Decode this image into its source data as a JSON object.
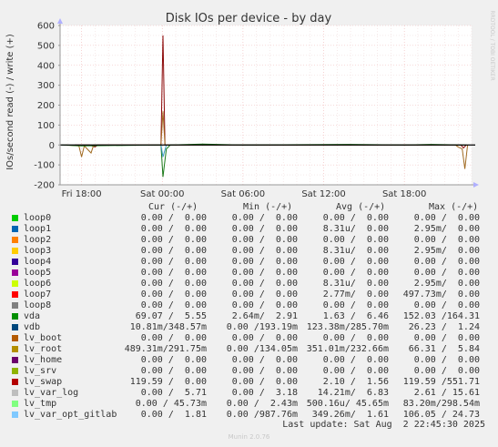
{
  "chart_data": {
    "type": "line",
    "title": "Disk IOs per device - by day",
    "ylabel": "IOs/second read (-) / write (+)",
    "ylim": [
      -200,
      600
    ],
    "yticks": [
      -200,
      -100,
      0,
      100,
      200,
      300,
      400,
      500,
      600
    ],
    "xticks": [
      {
        "label": "Fri 18:00",
        "t": 0
      },
      {
        "label": "Sat 00:00",
        "t": 6
      },
      {
        "label": "Sat 06:00",
        "t": 12
      },
      {
        "label": "Sat 12:00",
        "t": 18
      },
      {
        "label": "Sat 18:00",
        "t": 24
      }
    ],
    "xlim": [
      -1.6,
      29.0
    ],
    "grid": true,
    "side_label": "RRDTOOL / TOBI OETIKER",
    "series": [
      {
        "name": "lv_swap",
        "color": "#8c0a0a",
        "points": [
          [
            -0.5,
            0
          ],
          [
            0.6,
            0
          ],
          [
            1.0,
            -10
          ],
          [
            1.2,
            0
          ],
          [
            5.9,
            0
          ],
          [
            6.05,
            550
          ],
          [
            6.2,
            0
          ],
          [
            13.0,
            0
          ],
          [
            28.2,
            0
          ],
          [
            28.4,
            -15
          ],
          [
            28.6,
            0
          ]
        ]
      },
      {
        "name": "lv_root",
        "color": "#a06a20",
        "points": [
          [
            -1.2,
            0
          ],
          [
            -0.2,
            -5
          ],
          [
            0.0,
            -60
          ],
          [
            0.2,
            -5
          ],
          [
            0.7,
            -40
          ],
          [
            0.9,
            0
          ],
          [
            5.9,
            0
          ],
          [
            6.05,
            170
          ],
          [
            6.2,
            0
          ],
          [
            27.8,
            0
          ],
          [
            28.0,
            -10
          ],
          [
            28.3,
            -20
          ],
          [
            28.5,
            -120
          ],
          [
            28.7,
            0
          ]
        ]
      },
      {
        "name": "vda",
        "color": "#1a7a1a",
        "points": [
          [
            -1.5,
            0
          ],
          [
            0.0,
            -5
          ],
          [
            2.0,
            -3
          ],
          [
            5.9,
            0
          ],
          [
            6.05,
            -160
          ],
          [
            6.3,
            -20
          ],
          [
            6.6,
            0
          ],
          [
            9.0,
            5
          ],
          [
            12.0,
            0
          ],
          [
            20.0,
            3
          ],
          [
            24.0,
            0
          ],
          [
            26.0,
            3
          ],
          [
            28.6,
            0
          ]
        ]
      },
      {
        "name": "lv_var_log",
        "color": "#3a9ac0",
        "points": [
          [
            5.9,
            0
          ],
          [
            6.05,
            -60
          ],
          [
            6.3,
            0
          ]
        ]
      }
    ]
  },
  "legend": {
    "columns": [
      "Cur (-/+)",
      "Min (-/+)",
      "Avg (-/+)",
      "Max (-/+)"
    ],
    "rows": [
      {
        "name": "loop0",
        "color": "#00cc00",
        "cur": "0.00 /  0.00",
        "min": "0.00 /  0.00",
        "avg": "0.00 /  0.00",
        "max": "0.00 /  0.00"
      },
      {
        "name": "loop1",
        "color": "#0066b3",
        "cur": "0.00 /  0.00",
        "min": "0.00 /  0.00",
        "avg": "8.31u/  0.00",
        "max": "2.95m/  0.00"
      },
      {
        "name": "loop2",
        "color": "#ff8000",
        "cur": "0.00 /  0.00",
        "min": "0.00 /  0.00",
        "avg": "0.00 /  0.00",
        "max": "0.00 /  0.00"
      },
      {
        "name": "loop3",
        "color": "#ffcc00",
        "cur": "0.00 /  0.00",
        "min": "0.00 /  0.00",
        "avg": "8.31u/  0.00",
        "max": "2.95m/  0.00"
      },
      {
        "name": "loop4",
        "color": "#330099",
        "cur": "0.00 /  0.00",
        "min": "0.00 /  0.00",
        "avg": "0.00 /  0.00",
        "max": "0.00 /  0.00"
      },
      {
        "name": "loop5",
        "color": "#990099",
        "cur": "0.00 /  0.00",
        "min": "0.00 /  0.00",
        "avg": "0.00 /  0.00",
        "max": "0.00 /  0.00"
      },
      {
        "name": "loop6",
        "color": "#ccff00",
        "cur": "0.00 /  0.00",
        "min": "0.00 /  0.00",
        "avg": "8.31u/  0.00",
        "max": "2.95m/  0.00"
      },
      {
        "name": "loop7",
        "color": "#ff0000",
        "cur": "0.00 /  0.00",
        "min": "0.00 /  0.00",
        "avg": "2.77m/  0.00",
        "max": "497.73m/  0.00"
      },
      {
        "name": "loop8",
        "color": "#808080",
        "cur": "0.00 /  0.00",
        "min": "0.00 /  0.00",
        "avg": "0.00 /  0.00",
        "max": "0.00 /  0.00"
      },
      {
        "name": "vda",
        "color": "#008f00",
        "cur": "69.07 /  5.55",
        "min": "2.64m/  2.91",
        "avg": "1.63 /  6.46",
        "max": "152.03 /164.31"
      },
      {
        "name": "vdb",
        "color": "#00487d",
        "cur": "10.81m/348.57m",
        "min": "0.00 /193.19m",
        "avg": "123.38m/285.70m",
        "max": "26.23 /  1.24"
      },
      {
        "name": "lv_boot",
        "color": "#b35a00",
        "cur": "0.00 /  0.00",
        "min": "0.00 /  0.00",
        "avg": "0.00 /  0.00",
        "max": "0.00 /  0.00"
      },
      {
        "name": "lv_root",
        "color": "#b38f00",
        "cur": "489.31m/291.75m",
        "min": "0.00 /134.05m",
        "avg": "351.01m/232.66m",
        "max": "66.31 /  5.84"
      },
      {
        "name": "lv_home",
        "color": "#6b006b",
        "cur": "0.00 /  0.00",
        "min": "0.00 /  0.00",
        "avg": "0.00 /  0.00",
        "max": "0.00 /  0.00"
      },
      {
        "name": "lv_srv",
        "color": "#8fb300",
        "cur": "0.00 /  0.00",
        "min": "0.00 /  0.00",
        "avg": "0.00 /  0.00",
        "max": "0.00 /  0.00"
      },
      {
        "name": "lv_swap",
        "color": "#b30000",
        "cur": "119.59 /  0.00",
        "min": "0.00 /  0.00",
        "avg": "2.10 /  1.56",
        "max": "119.59 /551.71"
      },
      {
        "name": "lv_var_log",
        "color": "#bebebe",
        "cur": "0.00 /  5.71",
        "min": "0.00 /  3.18",
        "avg": "14.21m/  6.83",
        "max": "2.61 / 15.61"
      },
      {
        "name": "lv_tmp",
        "color": "#80ff80",
        "cur": "0.00 / 45.73m",
        "min": "0.00 /  2.43m",
        "avg": "500.16u/ 45.65m",
        "max": "83.20m/298.54m"
      },
      {
        "name": "lv_var_opt_gitlab",
        "color": "#80c9ff",
        "cur": "0.00 /  1.81",
        "min": "0.00 /987.76m",
        "avg": "349.26m/  1.61",
        "max": "106.05 / 24.73"
      }
    ],
    "last_update": "Last update: Sat Aug  2 22:45:30 2025",
    "footer": "Munin 2.0.76"
  }
}
